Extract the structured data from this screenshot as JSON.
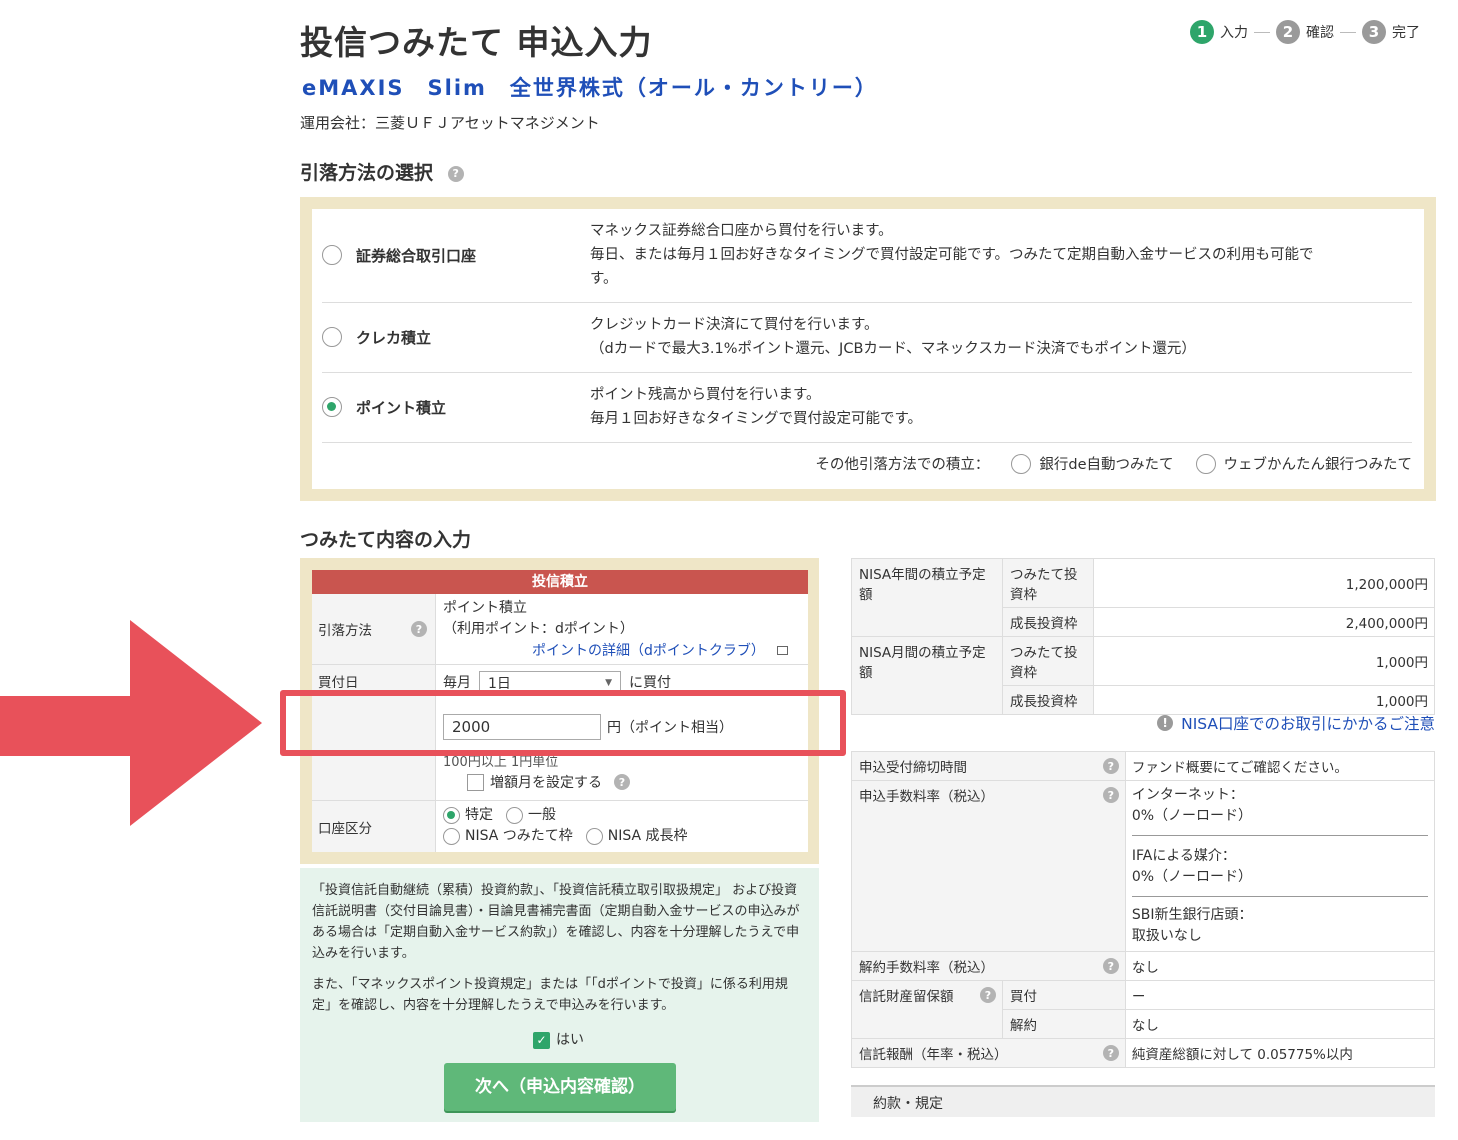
{
  "header": {
    "title": "投信つみたて 申込入力",
    "fund_name": "eMAXIS　Slim　全世界株式（オール・カントリー）",
    "company": "運用会社：三菱ＵＦＪアセットマネジメント"
  },
  "steps": [
    {
      "num": "1",
      "label": "入力",
      "active": true
    },
    {
      "num": "2",
      "label": "確認",
      "active": false
    },
    {
      "num": "3",
      "label": "完了",
      "active": false
    }
  ],
  "withdrawal": {
    "section_title": "引落方法の選択",
    "options": [
      {
        "label": "証券総合取引口座",
        "selected": false,
        "desc": [
          "マネックス証券総合口座から買付を行います。",
          "毎日、または毎月１回お好きなタイミングで買付設定可能です。つみたて定期自動入金サービスの利用も可能で",
          "す。"
        ]
      },
      {
        "label": "クレカ積立",
        "selected": false,
        "desc": [
          "クレジットカード決済にて買付を行います。",
          "（dカードで最大3.1%ポイント還元、JCBカード、マネックスカード決済でもポイント還元）"
        ]
      },
      {
        "label": "ポイント積立",
        "selected": true,
        "desc": [
          "ポイント残高から買付を行います。",
          "毎月１回お好きなタイミングで買付設定可能です。"
        ]
      }
    ],
    "other_label": "その他引落方法での積立：",
    "other_options": [
      "銀行de自動つみたて",
      "ウェブかんたん銀行つみたて"
    ]
  },
  "form": {
    "section_title": "つみたて内容の入力",
    "header": "投信積立",
    "method_label": "引落方法",
    "method_value_1": "ポイント積立",
    "method_value_2": "（利用ポイント：dポイント）",
    "method_link": "ポイントの詳細（dポイントクラブ）",
    "buy_day_label": "買付日",
    "buy_day_prefix": "毎月",
    "buy_day_value": "1日",
    "buy_day_suffix": "に買付",
    "amount_value": "2000",
    "amount_suffix": "円（ポイント相当）",
    "amount_note": "100円以上 1円単位",
    "increase_label": "増額月を設定する",
    "account_label": "口座区分",
    "account_options": [
      {
        "label": "特定",
        "selected": true
      },
      {
        "label": "一般",
        "selected": false
      },
      {
        "label": "NISA つみたて枠",
        "selected": false
      },
      {
        "label": "NISA 成長枠",
        "selected": false
      }
    ]
  },
  "agreement": {
    "text1": "「投資信託自動継続（累積）投資約款」、「投資信託積立取引取扱規定」 および投資信託説明書（交付目論見書）・目論見書補完書面（定期自動入金サービスの申込みがある場合は「定期自動入金サービス約款」）を確認し、内容を十分理解したうえで申込みを行います。",
    "text2": "また、「マネックスポイント投資規定」または「「dポイントで投資」に係る利用規定」を確認し、内容を十分理解したうえで申込みを行います。",
    "check_label": "はい",
    "next_button": "次へ（申込内容確認）"
  },
  "nisa": {
    "annual_label": "NISA年間の積立予定額",
    "monthly_label": "NISA月間の積立予定額",
    "tsumitate_label": "つみたて投資枠",
    "growth_label": "成長投資枠",
    "annual_tsumitate": "1,200,000円",
    "annual_growth": "2,400,000円",
    "monthly_tsumitate": "1,000円",
    "monthly_growth": "1,000円",
    "caution_link": "NISA口座でのお取引にかかるご注意"
  },
  "fund_info": {
    "deadline_label": "申込受付締切時間",
    "deadline_value": "ファンド概要にてご確認ください。",
    "fee_label": "申込手数料率（税込）",
    "fee_internet_1": "インターネット：",
    "fee_internet_2": "0%（ノーロード）",
    "fee_ifa_1": "IFAによる媒介：",
    "fee_ifa_2": "0%（ノーロード）",
    "fee_sbi_1": "SBI新生銀行店頭：",
    "fee_sbi_2": "取扱いなし",
    "cancel_label": "解約手数料率（税込）",
    "cancel_value": "なし",
    "reserve_label": "信託財産留保額",
    "reserve_buy": "買付",
    "reserve_buy_value": "ー",
    "reserve_sell": "解約",
    "reserve_sell_value": "なし",
    "trust_label": "信託報酬（年率・税込）",
    "trust_value": "純資産総額に対して 0.05775%以内",
    "terms_label": "約款・規定"
  }
}
